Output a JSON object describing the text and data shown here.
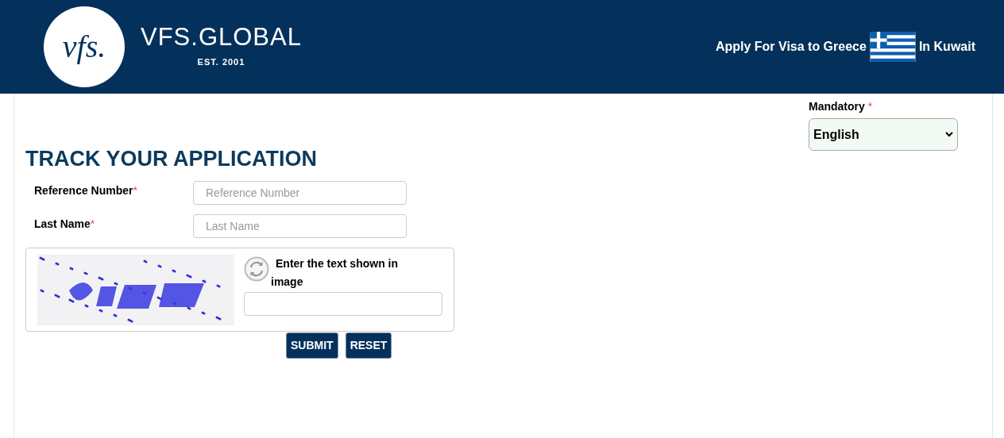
{
  "header": {
    "logo_mark": "vfs.",
    "brand": "VFS.GLOBAL",
    "established": "EST. 2001",
    "tagline_before": "Apply For Visa to Greece",
    "tagline_after": "In Kuwait"
  },
  "language": {
    "label": "Mandatory",
    "required_mark": "*",
    "value": "English"
  },
  "title": "TRACK YOUR APPLICATION",
  "fields": [
    {
      "label": "Reference Number",
      "required_mark": "*",
      "placeholder": "Reference Number"
    },
    {
      "label": "Last Name",
      "required_mark": "*",
      "placeholder": "Last Name"
    }
  ],
  "captcha": {
    "prompt": "Enter the text shown in image"
  },
  "buttons": [
    "SUBMIT",
    "RESET"
  ]
}
